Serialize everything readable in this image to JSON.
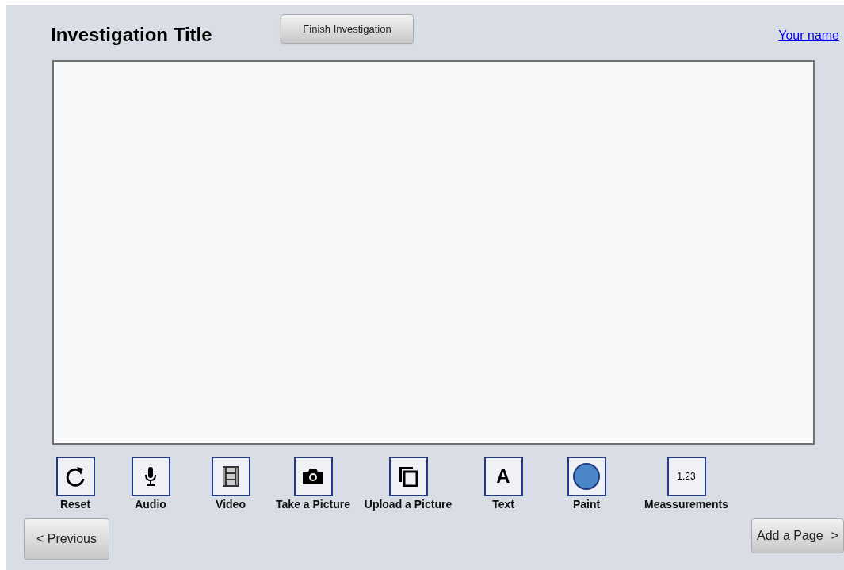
{
  "header": {
    "title": "Investigation Title",
    "finish_button": "Finish Investigation",
    "user_link": "Your name"
  },
  "tools": [
    {
      "kind": "reset",
      "label": "Reset"
    },
    {
      "kind": "audio",
      "label": "Audio"
    },
    {
      "kind": "video",
      "label": "Video"
    },
    {
      "kind": "camera",
      "label": "Take a Picture"
    },
    {
      "kind": "upload",
      "label": "Upload a Picture"
    },
    {
      "kind": "text",
      "glyph": "A",
      "label": "Text"
    },
    {
      "kind": "paint",
      "label": "Paint"
    },
    {
      "kind": "number",
      "glyph": "1.23",
      "label": "Meassurements"
    }
  ],
  "navigation": {
    "previous": "< Previous",
    "next": "Add a Page",
    "next_arrow": ">"
  }
}
